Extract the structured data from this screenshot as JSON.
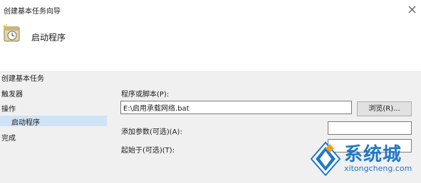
{
  "window": {
    "title": "创建基本任务向导"
  },
  "header": {
    "title": "启动程序"
  },
  "sidebar": {
    "items": [
      {
        "label": "创建基本任务"
      },
      {
        "label": "触发器"
      },
      {
        "label": "操作"
      },
      {
        "label": "启动程序"
      },
      {
        "label": "完成"
      }
    ]
  },
  "form": {
    "program_label": "程序或脚本(P):",
    "program_value": "E:\\启用承载网络.bat",
    "browse_label": "浏览(R)...",
    "args_label": "添加参数(可选)(A):",
    "args_value": "",
    "startin_label": "起始于(可选)(T):",
    "startin_value": ""
  },
  "watermark": {
    "brand_cn": "系统城",
    "brand_en": "xitongcheng.com",
    "color": "#1f78c8"
  },
  "colors": {
    "selected_item": "#cfe3f7",
    "panel_bg": "#f0f0f0"
  }
}
